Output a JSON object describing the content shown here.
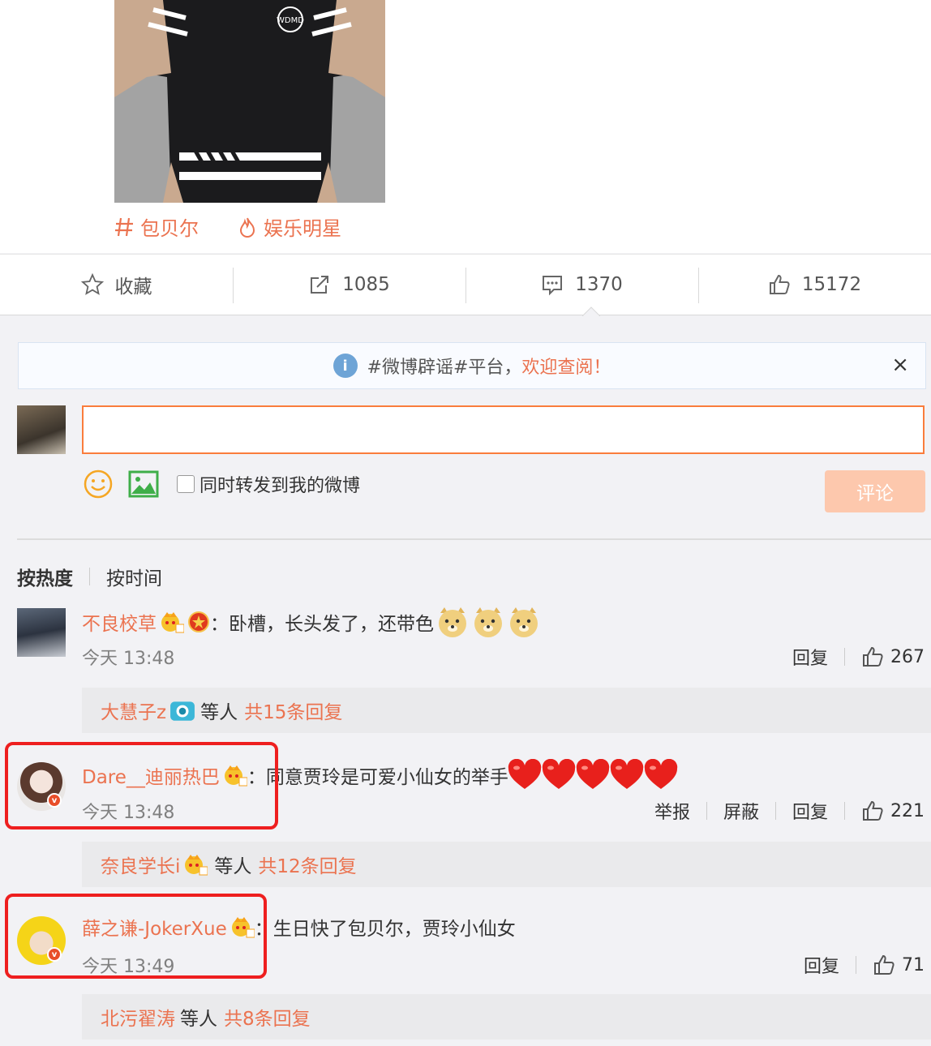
{
  "post": {
    "tags": [
      {
        "icon": "hash-icon",
        "label": "包贝尔"
      },
      {
        "icon": "flame-icon",
        "label": "娱乐明星"
      }
    ],
    "shirt_logo": "WDMD"
  },
  "actions": {
    "favorite_label": "收藏",
    "repost_count": "1085",
    "comment_count": "1370",
    "like_count": "15172"
  },
  "notice": {
    "text": "#微博辟谣#平台，",
    "highlight": "欢迎查阅！",
    "close": "×"
  },
  "composer": {
    "value": "",
    "repost_label": "同时转发到我的微博",
    "submit_label": "评论"
  },
  "sort": {
    "hot": "按热度",
    "time": "按时间"
  },
  "comments": [
    {
      "user": "不良校草",
      "sep": "：",
      "text": "卧槽，长头发了，还带色",
      "time": "今天 13:48",
      "reply_label": "回复",
      "likes": "267",
      "replies": {
        "user": "大慧子z",
        "mid": "等人",
        "count": "共15条回复"
      }
    },
    {
      "user": "Dare__迪丽热巴",
      "sep": "：",
      "text": "同意贾玲是可爱小仙女的举手",
      "time": "今天 13:48",
      "report_label": "举报",
      "block_label": "屏蔽",
      "reply_label": "回复",
      "likes": "221",
      "replies": {
        "user": "奈良学长i",
        "mid": "等人",
        "count": "共12条回复"
      }
    },
    {
      "user": "薛之谦-JokerXue",
      "sep": "：",
      "text": "生日快了包贝尔，贾玲小仙女",
      "time": "今天 13:49",
      "reply_label": "回复",
      "likes": "71",
      "replies": {
        "user": "北污翟涛",
        "mid": "等人",
        "count": "共8条回复"
      }
    }
  ],
  "colors": {
    "accent": "#eb7350",
    "highlight_box": "#ee1f1f",
    "submit_disabled": "#fdc8ad",
    "input_border": "#fa7d3c"
  }
}
